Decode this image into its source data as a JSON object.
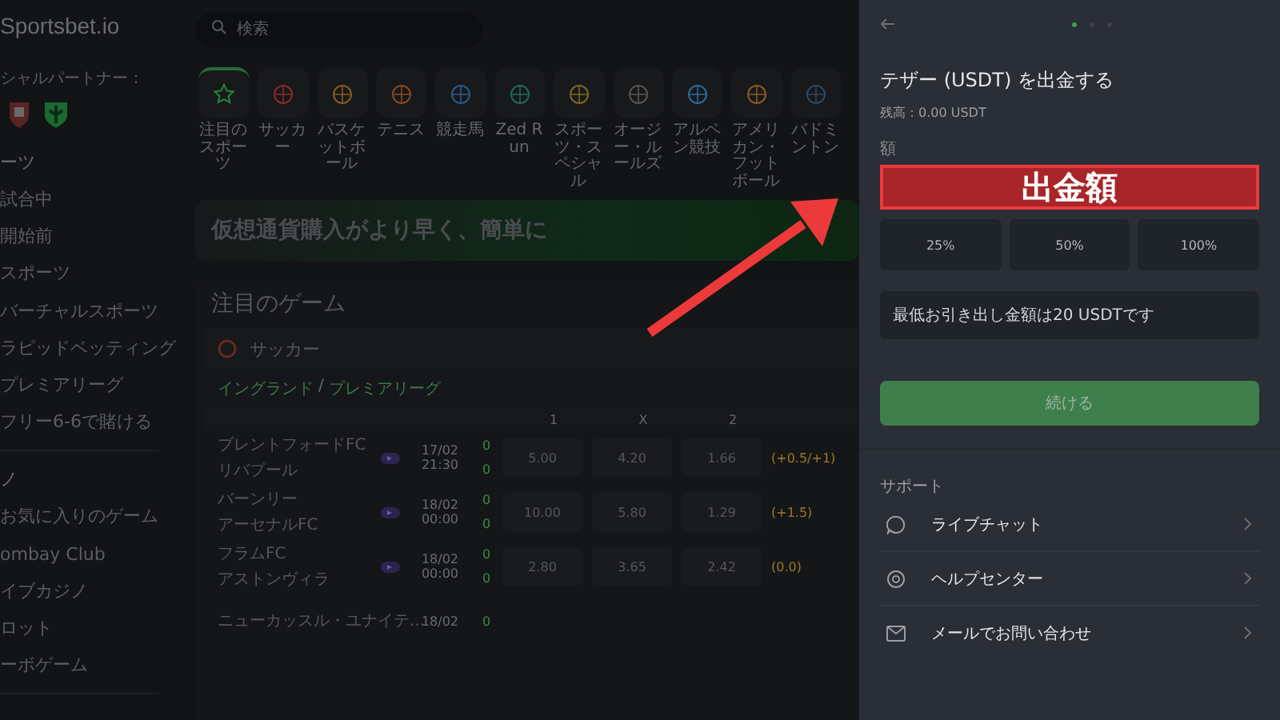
{
  "sidebar": {
    "logo": "Sportsbet.io",
    "partner_label": "シャルパートナー：",
    "sections": [
      {
        "title": "ーツ",
        "items": [
          "試合中",
          "開始前",
          "スポーツ",
          "バーチャルスポーツ",
          "ラピッドベッティング",
          "プレミアリーグ",
          "フリー6-6で賭ける"
        ]
      },
      {
        "title": "ノ",
        "items": [
          "お気に入りのゲーム",
          "ombay Club",
          "イブカジノ",
          "ロット",
          "ーボゲーム"
        ]
      }
    ]
  },
  "search": {
    "placeholder": "検索"
  },
  "sports": [
    {
      "label": "注目のスポーツ",
      "selected": true,
      "color": "#1f8a3a"
    },
    {
      "label": "サッカー",
      "selected": false,
      "color": "#8a2a2a"
    },
    {
      "label": "バスケットボール",
      "selected": false,
      "color": "#8a5a20"
    },
    {
      "label": "テニス",
      "selected": false,
      "color": "#8a4a20"
    },
    {
      "label": "競走馬",
      "selected": false,
      "color": "#2a5a8a"
    },
    {
      "label": "Zed Run",
      "selected": false,
      "color": "#1f6a5a"
    },
    {
      "label": "スポーツ・スペシャル",
      "selected": false,
      "color": "#7a6a20"
    },
    {
      "label": "オージー・ルールズ",
      "selected": false,
      "color": "#555555"
    },
    {
      "label": "アルペン競技",
      "selected": false,
      "color": "#2a6a9a"
    },
    {
      "label": "アメリカン・フットボール",
      "selected": false,
      "color": "#8a5a20"
    },
    {
      "label": "バドミントン",
      "selected": false,
      "color": "#2a4a6a"
    }
  ],
  "banner": {
    "text": "仮想通貨購入がより早く、簡単に"
  },
  "featured": {
    "title": "注目のゲーム",
    "sport": "サッカー",
    "country": "イングランド",
    "separator": "/",
    "league": "プレミアリーグ",
    "columns": [
      "1",
      "X",
      "2"
    ],
    "matches": [
      {
        "teams": [
          "ブレントフォードFC",
          "リバプール"
        ],
        "date": "17/02",
        "time": "21:30",
        "scores": [
          "0",
          "0"
        ],
        "odds": [
          "5.00",
          "4.20",
          "1.66"
        ],
        "handicap": "(+0.5/+1)"
      },
      {
        "teams": [
          "バーンリー",
          "アーセナルFC"
        ],
        "date": "18/02",
        "time": "00:00",
        "scores": [
          "0",
          "0"
        ],
        "odds": [
          "10.00",
          "5.80",
          "1.29"
        ],
        "handicap": "(+1.5)"
      },
      {
        "teams": [
          "フラムFC",
          "アストンヴィラ"
        ],
        "date": "18/02",
        "time": "00:00",
        "scores": [
          "0",
          "0"
        ],
        "odds": [
          "2.80",
          "3.65",
          "2.42"
        ],
        "handicap": "(0.0)"
      },
      {
        "teams": [
          "ニューカッスル・ユナイテ..."
        ],
        "date": "18/02",
        "scores": [
          "0"
        ]
      }
    ]
  },
  "panel": {
    "steps": [
      {
        "selected": true
      },
      {
        "selected": false
      },
      {
        "selected": false
      }
    ],
    "title": "テザー (USDT) を出金する",
    "balance": "残高：0.00 USDT",
    "field_label": "額",
    "annotation": "出金額",
    "percent_buttons": [
      "25%",
      "50%",
      "100%"
    ],
    "notice": "最低お引き出し金額は20 USDTです",
    "continue": {
      "label": "続ける",
      "disabled": true
    },
    "support_title": "サポート",
    "support_items": [
      {
        "kind": "chat",
        "label": "ライブチャット"
      },
      {
        "kind": "help",
        "label": "ヘルプセンター"
      },
      {
        "kind": "mail",
        "label": "メールでお問い合わせ"
      }
    ]
  }
}
